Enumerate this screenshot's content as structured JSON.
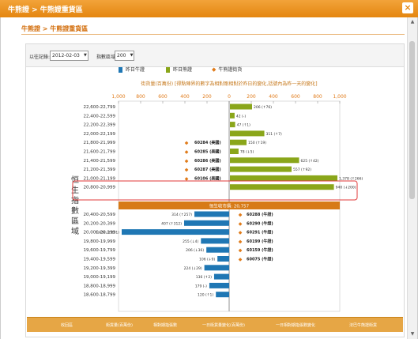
{
  "window": {
    "title": "牛熊證 > 牛熊證重貨區"
  },
  "breadcrumb": "牛熊證 > 牛熊證重貨區",
  "toolbar": {
    "record_label": "以往記錄:",
    "date_value": "2012-02-03",
    "step_label": "指數區域:",
    "step_value": "200"
  },
  "legend": [
    {
      "label": "昨日牛證",
      "color": "#1f77b4"
    },
    {
      "label": "昨日熊證",
      "color": "#8aa61a"
    },
    {
      "label": "牛熊證街貨",
      "color": "#e07b1a"
    }
  ],
  "subtitle": "街貨量(百萬份) [得點陣界的數字為相對剛相對於昨日的變化,括號內為昨一天的變化]",
  "side_label": "恒生指數區域",
  "hsi_label": "恒生收市價: 20,757",
  "footer": [
    "收回區",
    "街貨量(百萬份)",
    "相對期指張數",
    "一日街貨量變化(百萬份)",
    "一日相對期指張數變化",
    "法巴牛熊證街貨"
  ],
  "chart_data": {
    "type": "bar",
    "x_ticks": [
      "1,000",
      "800",
      "600",
      "400",
      "200",
      "0",
      "200",
      "400",
      "600",
      "800",
      "1,000"
    ],
    "bear_rows": [
      {
        "range": "22,600-22,799",
        "value": 200,
        "label": "206 (↑76)",
        "warrant": ""
      },
      {
        "range": "22,400-22,599",
        "value": 42,
        "label": "42 (-)",
        "warrant": ""
      },
      {
        "range": "22,200-22,399",
        "value": 47,
        "label": "47 (↑1)",
        "warrant": ""
      },
      {
        "range": "22,000-22,199",
        "value": 311,
        "label": "311 (↑7)",
        "warrant": ""
      },
      {
        "range": "21,800-21,999",
        "value": 150,
        "label": "150 (↑19)",
        "warrant": "60284 (美國)"
      },
      {
        "range": "21,600-21,799",
        "value": 78,
        "label": "78 (↓5)",
        "warrant": "60285 (美國)"
      },
      {
        "range": "21,400-21,599",
        "value": 625,
        "label": "625 (↑42)",
        "warrant": "60286 (美國)"
      },
      {
        "range": "21,200-21,399",
        "value": 557,
        "label": "557 (↑92)",
        "warrant": "60287 (美國)"
      },
      {
        "range": "21,000-21,199",
        "value": 1378,
        "label": "1,378 (↑266)",
        "warrant": "60106 (美國)"
      },
      {
        "range": "20,800-20,999",
        "value": 940,
        "label": "940 (↓200)",
        "warrant": ""
      }
    ],
    "bull_rows": [
      {
        "range": "20,400-20,599",
        "value": 314,
        "label": "314 (↑257)",
        "warrant": "60288 (牛證)"
      },
      {
        "range": "20,200-20,399",
        "value": 407,
        "label": "407 (↑312)",
        "warrant": "60290 (牛證)"
      },
      {
        "range": "20,000-20,199",
        "value": 1032,
        "label": "1,032 (↑831)",
        "warrant": "60291 (牛證)"
      },
      {
        "range": "19,800-19,999",
        "value": 255,
        "label": "255 (↓4)",
        "warrant": "60199 (牛證)"
      },
      {
        "range": "19,600-19,799",
        "value": 206,
        "label": "206 (↓36)",
        "warrant": "60159 (牛證)"
      },
      {
        "range": "19,400-19,599",
        "value": 106,
        "label": "106 (↓9)",
        "warrant": "60075 (牛證)"
      },
      {
        "range": "19,200-19,399",
        "value": 224,
        "label": "224 (↓29)",
        "warrant": ""
      },
      {
        "range": "19,000-19,199",
        "value": 136,
        "label": "136 (↑2)",
        "warrant": ""
      },
      {
        "range": "18,800-18,999",
        "value": 179,
        "label": "179 (-)",
        "warrant": ""
      },
      {
        "range": "18,600-18,799",
        "value": 120,
        "label": "120 (↑1)",
        "warrant": ""
      }
    ]
  }
}
